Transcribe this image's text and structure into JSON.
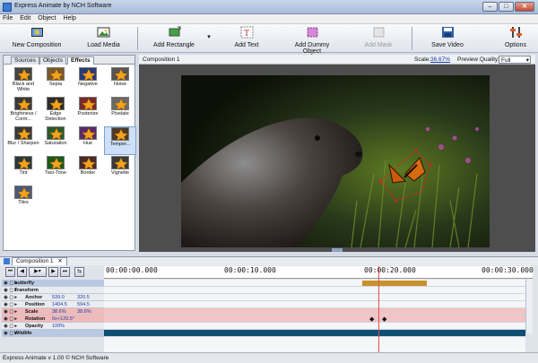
{
  "window": {
    "title": "Express Animate by NCH Software"
  },
  "menu": [
    "File",
    "Edit",
    "Object",
    "Help"
  ],
  "toolbar": {
    "new_composition": "New Composition",
    "load_media": "Load Media",
    "add_rectangle": "Add Rectangle",
    "add_text": "Add Text",
    "add_dummy_object": "Add Dummy Object",
    "add_mask": "Add Mask",
    "save_video": "Save Video",
    "options": "Options"
  },
  "panel_tabs": [
    "Sources",
    "Objects",
    "Effects"
  ],
  "effects": [
    "Black and White",
    "Sepia",
    "Negative",
    "Noise",
    "Brightness / Contr...",
    "Edge Detection",
    "Posterize",
    "Pixelate",
    "Blur / Sharpen",
    "Saturation",
    "Hue",
    "Temper...",
    "Tint",
    "Two-Tone",
    "Border",
    "Vignette",
    "Tiles"
  ],
  "composition": {
    "name": "Composition 1",
    "scale_label": "Scale:",
    "scale_value": "36.67%",
    "quality_label": "Preview Quality:",
    "quality_value": "Full"
  },
  "timeline": {
    "tab": "Composition 1",
    "ruler_ticks": [
      "00:00:00.000",
      "00:00:10.000",
      "00:00:20.000",
      "00:00:30.000"
    ],
    "tracks": [
      {
        "name": "butterfly",
        "v1": "",
        "v2": ""
      },
      {
        "name": "Transform",
        "v1": "",
        "v2": ""
      },
      {
        "name": "Anchor",
        "v1": "539.0",
        "v2": "320.5"
      },
      {
        "name": "Position",
        "v1": "1404.5",
        "v2": "594.5"
      },
      {
        "name": "Scale",
        "v1": "38.6%",
        "v2": "38.6%"
      },
      {
        "name": "Rotation",
        "v1": "0x+129.5°",
        "v2": ""
      },
      {
        "name": "Opacity",
        "v1": "100%",
        "v2": ""
      },
      {
        "name": "Wildlife",
        "v1": "",
        "v2": ""
      }
    ]
  },
  "status": "Express Animate v 1.00 © NCH Software",
  "colors": {
    "accent": "#3a7bd5",
    "keyframe_row": "#f2b9b9",
    "playhead": "#d9534f",
    "clip_bar": "#c8922a"
  }
}
